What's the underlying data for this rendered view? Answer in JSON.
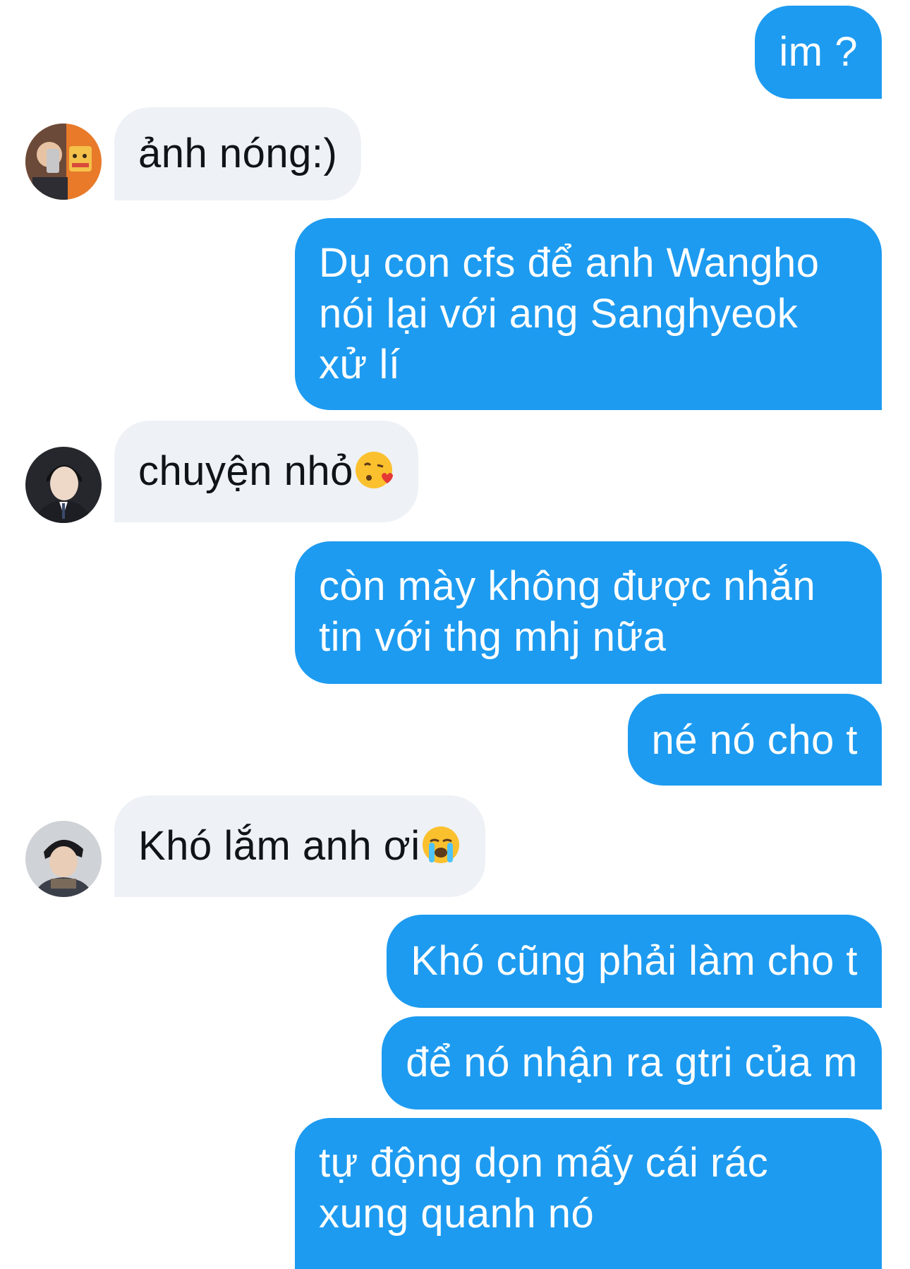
{
  "messages": [
    {
      "sender": "me",
      "text": "im ?"
    },
    {
      "sender": "contact",
      "avatar": "avatar-1",
      "text": "ảnh nóng:)"
    },
    {
      "sender": "me",
      "lines": [
        "Dụ con cfs để anh Wangho",
        "nói lại với ang Sanghyeok",
        "xử lí"
      ]
    },
    {
      "sender": "contact",
      "avatar": "avatar-2",
      "text": "chuyện nhỏ",
      "emoji": "kissing-heart-emoji"
    },
    {
      "sender": "me",
      "lines": [
        "còn mày không được nhắn",
        "tin với thg mhj nữa"
      ]
    },
    {
      "sender": "me",
      "text": "né nó cho t"
    },
    {
      "sender": "contact",
      "avatar": "avatar-3",
      "text": "Khó lắm anh ơi",
      "emoji": "crying-face-emoji"
    },
    {
      "sender": "me",
      "text": "Khó cũng phải làm cho t"
    },
    {
      "sender": "me",
      "text": "để nó nhận ra gtri của m"
    },
    {
      "sender": "me",
      "lines": [
        "tự động dọn mấy cái rác",
        "xung quanh nó"
      ]
    }
  ],
  "colors": {
    "outgoing_bubble": "#1d9bf0",
    "incoming_bubble": "#eef1f5",
    "outgoing_text": "#ffffff",
    "incoming_text": "#0f1419"
  }
}
